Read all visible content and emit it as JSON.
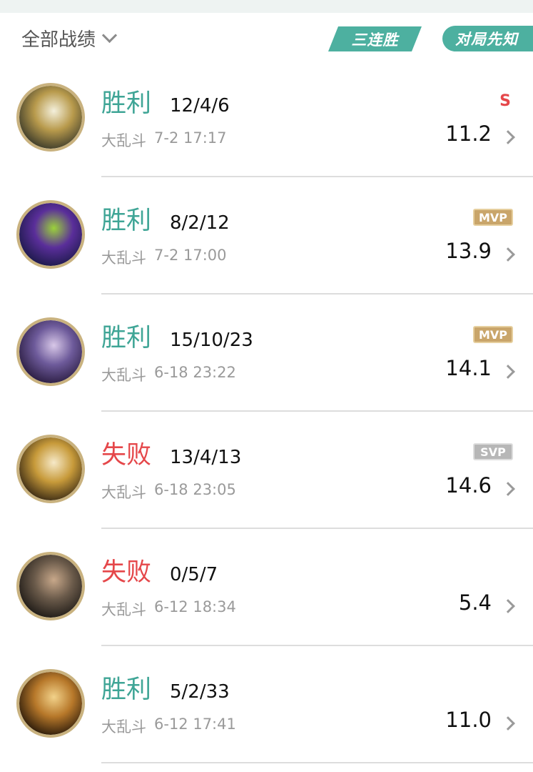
{
  "header": {
    "filter_label": "全部战绩",
    "streak_tag": "三连胜",
    "preview_tag": "对局先知"
  },
  "matches": [
    {
      "result": "胜利",
      "result_type": "win",
      "kda": "12/4/6",
      "mode": "大乱斗",
      "time": "7-2 17:17",
      "score": "11.2",
      "badge": "S",
      "badge_type": "streak",
      "avatar_icon": "champion-portrait-icon",
      "avatar_colors": [
        "#3b3a2a",
        "#b89a4c",
        "#f4f0dc"
      ]
    },
    {
      "result": "胜利",
      "result_type": "win",
      "kda": "8/2/12",
      "mode": "大乱斗",
      "time": "7-2 17:00",
      "score": "13.9",
      "badge": "MVP",
      "badge_type": "mvp",
      "avatar_icon": "champion-portrait-icon",
      "avatar_colors": [
        "#1c1a4a",
        "#5a2e9a",
        "#9bd23a"
      ]
    },
    {
      "result": "胜利",
      "result_type": "win",
      "kda": "15/10/23",
      "mode": "大乱斗",
      "time": "6-18 23:22",
      "score": "14.1",
      "badge": "MVP",
      "badge_type": "mvp",
      "avatar_icon": "champion-portrait-icon",
      "avatar_colors": [
        "#2a1c40",
        "#6d5a9a",
        "#d8c8e8"
      ]
    },
    {
      "result": "失败",
      "result_type": "loss",
      "kda": "13/4/13",
      "mode": "大乱斗",
      "time": "6-18 23:05",
      "score": "14.6",
      "badge": "SVP",
      "badge_type": "svp",
      "avatar_icon": "champion-portrait-icon",
      "avatar_colors": [
        "#3a2a14",
        "#c79a3a",
        "#f6e9c8"
      ]
    },
    {
      "result": "失败",
      "result_type": "loss",
      "kda": "0/5/7",
      "mode": "大乱斗",
      "time": "6-12 18:34",
      "score": "5.4",
      "badge": "",
      "badge_type": "none",
      "avatar_icon": "champion-portrait-icon",
      "avatar_colors": [
        "#1e1a16",
        "#6a5a4a",
        "#c8a88a"
      ]
    },
    {
      "result": "胜利",
      "result_type": "win",
      "kda": "5/2/33",
      "mode": "大乱斗",
      "time": "6-12 17:41",
      "score": "11.0",
      "badge": "",
      "badge_type": "none",
      "avatar_icon": "champion-portrait-icon",
      "avatar_colors": [
        "#2a1a0a",
        "#b7782a",
        "#f2d28a"
      ]
    }
  ]
}
